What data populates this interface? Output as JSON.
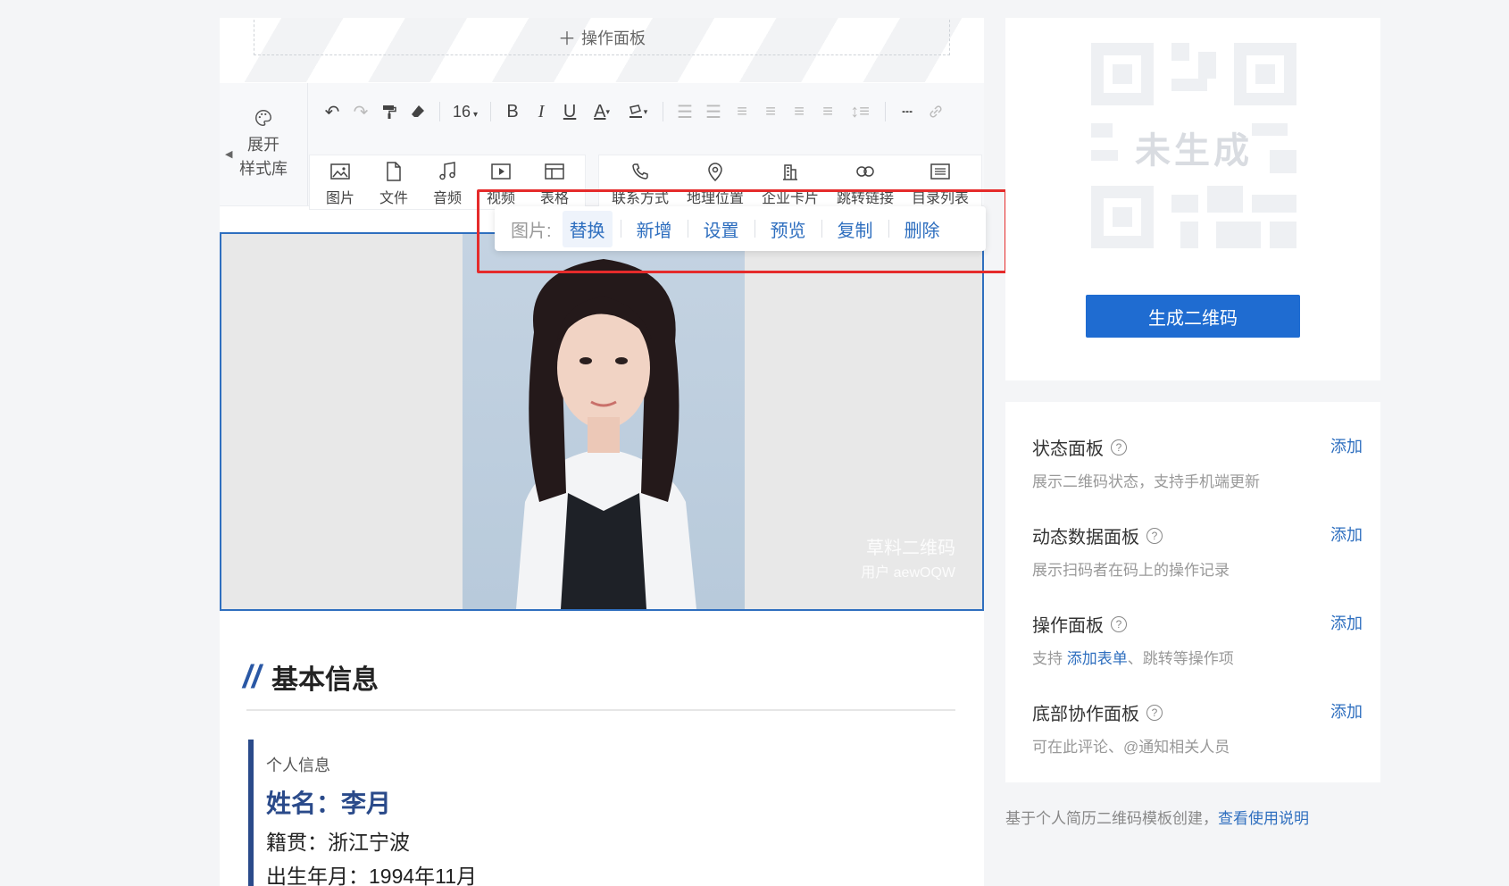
{
  "editor": {
    "op_panel_label": "操作面板",
    "style_library": {
      "line1": "展开",
      "line2": "样式库"
    },
    "font_size": "16",
    "insert_tools": [
      {
        "label": "图片",
        "icon": "image-icon"
      },
      {
        "label": "文件",
        "icon": "file-icon"
      },
      {
        "label": "音频",
        "icon": "music-icon"
      },
      {
        "label": "视频",
        "icon": "video-icon"
      },
      {
        "label": "表格",
        "icon": "table-icon"
      }
    ],
    "module_tools": [
      {
        "label": "联系方式",
        "icon": "phone-icon"
      },
      {
        "label": "地理位置",
        "icon": "location-icon"
      },
      {
        "label": "企业卡片",
        "icon": "building-icon"
      },
      {
        "label": "跳转链接",
        "icon": "link-icon"
      },
      {
        "label": "目录列表",
        "icon": "list-icon"
      }
    ],
    "image_menu": {
      "label": "图片:",
      "actions": [
        "替换",
        "新增",
        "设置",
        "预览",
        "复制",
        "删除"
      ]
    },
    "watermark": {
      "line1": "草料二维码",
      "line2": "用户 aewOQW"
    },
    "section_title": "基本信息",
    "info": {
      "subheading": "个人信息",
      "name": "姓名：李月",
      "origin": "籍贯：浙江宁波",
      "birth": "出生年月：1994年11月"
    }
  },
  "qr": {
    "status_text": "未生成",
    "generate_button": "生成二维码"
  },
  "panels": [
    {
      "name": "状态面板",
      "add": "添加",
      "desc": "展示二维码状态，支持手机端更新"
    },
    {
      "name": "动态数据面板",
      "add": "添加",
      "desc": "展示扫码者在码上的操作记录"
    },
    {
      "name": "操作面板",
      "add": "添加",
      "desc_prefix": "支持 ",
      "desc_link": "添加表单",
      "desc_suffix": "、跳转等操作项"
    },
    {
      "name": "底部协作面板",
      "add": "添加",
      "desc": "可在此评论、@通知相关人员"
    }
  ],
  "footer": {
    "text": "基于个人简历二维码模板创建，",
    "link": "查看使用说明"
  },
  "colors": {
    "accent": "#1f6cd1",
    "link": "#2f6fbf",
    "highlight": "#e52b2b",
    "heading_bar": "#2a4a8a"
  }
}
